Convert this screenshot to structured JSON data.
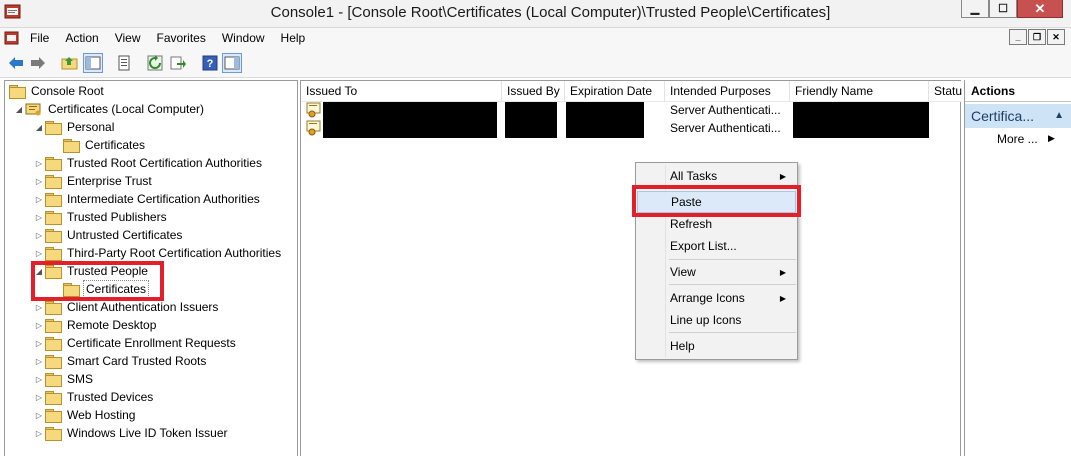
{
  "window": {
    "title": "Console1 - [Console Root\\Certificates (Local Computer)\\Trusted People\\Certificates]",
    "minimize": "▁",
    "maximize": "☐",
    "close": "✕"
  },
  "menubar": {
    "items": [
      "File",
      "Action",
      "View",
      "Favorites",
      "Window",
      "Help"
    ],
    "mdi_minimize": "_",
    "mdi_restore": "❐",
    "mdi_close": "✕"
  },
  "toolbar": [
    "back-icon",
    "forward-icon",
    "up-folder-icon",
    "show-hide-tree-icon",
    "properties-icon",
    "refresh-icon",
    "export-list-icon",
    "help-icon",
    "show-hide-action-pane-icon"
  ],
  "tree": {
    "root": "Console Root",
    "computer": "Certificates (Local Computer)",
    "items": [
      {
        "label": "Personal",
        "expanded": true
      },
      {
        "label": "Certificates",
        "child": true
      },
      {
        "label": "Trusted Root Certification Authorities"
      },
      {
        "label": "Enterprise Trust"
      },
      {
        "label": "Intermediate Certification Authorities"
      },
      {
        "label": "Trusted Publishers"
      },
      {
        "label": "Untrusted Certificates"
      },
      {
        "label": "Third-Party Root Certification Authorities"
      },
      {
        "label": "Trusted People",
        "expanded": true
      },
      {
        "label": "Certificates",
        "child": true,
        "selected": true
      },
      {
        "label": "Client Authentication Issuers"
      },
      {
        "label": "Remote Desktop"
      },
      {
        "label": "Certificate Enrollment Requests"
      },
      {
        "label": "Smart Card Trusted Roots"
      },
      {
        "label": "SMS"
      },
      {
        "label": "Trusted Devices"
      },
      {
        "label": "Web Hosting"
      },
      {
        "label": "Windows Live ID Token Issuer"
      }
    ]
  },
  "list": {
    "columns": [
      "Issued To",
      "Issued By",
      "Expiration Date",
      "Intended Purposes",
      "Friendly Name",
      "Status"
    ],
    "rows": [
      {
        "intended_purposes": "Server Authenticati..."
      },
      {
        "intended_purposes": "Server Authenticati..."
      }
    ]
  },
  "actions": {
    "header": "Actions",
    "section": "Certifica...",
    "more": "More ..."
  },
  "context_menu": {
    "items": [
      "All Tasks",
      "Paste",
      "Refresh",
      "Export List...",
      "View",
      "Arrange Icons",
      "Line up Icons",
      "Help"
    ],
    "highlighted": "Paste"
  },
  "colors": {
    "highlight_box": "#e3202a",
    "menu_highlight": "#dce9f8",
    "actions_section": "#cfe3f7"
  }
}
